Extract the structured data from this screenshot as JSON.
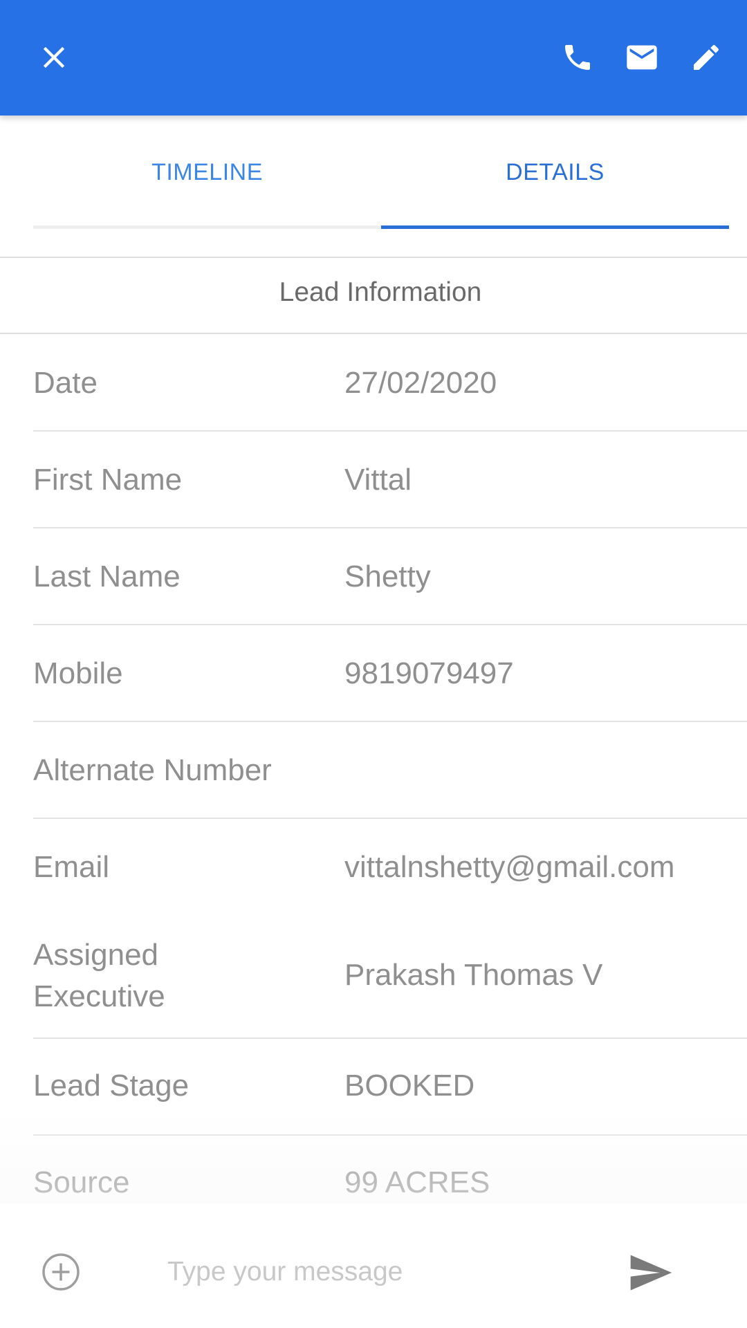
{
  "appbar": {
    "close_icon": "close-icon",
    "phone_icon": "phone-icon",
    "mail_icon": "mail-icon",
    "edit_icon": "edit-icon",
    "color": "#2671e6"
  },
  "tabs": [
    {
      "label": "TIMELINE",
      "active": false
    },
    {
      "label": "DETAILS",
      "active": true
    }
  ],
  "section": {
    "title": "Lead Information"
  },
  "fields": [
    {
      "label": "Date",
      "value": "27/02/2020"
    },
    {
      "label": "First Name",
      "value": "Vittal"
    },
    {
      "label": "Last Name",
      "value": "Shetty"
    },
    {
      "label": "Mobile",
      "value": "9819079497"
    },
    {
      "label": "Alternate Number",
      "value": ""
    },
    {
      "label": "Email",
      "value": "vittalnshetty@gmail.com"
    },
    {
      "label": "Assigned Executive",
      "value": "Prakash Thomas V"
    },
    {
      "label": "Lead Stage",
      "value": "BOOKED"
    },
    {
      "label": "Source",
      "value": "99 ACRES"
    }
  ],
  "composer": {
    "placeholder": "Type your message",
    "add_icon": "add-circle-icon",
    "send_icon": "send-icon"
  }
}
